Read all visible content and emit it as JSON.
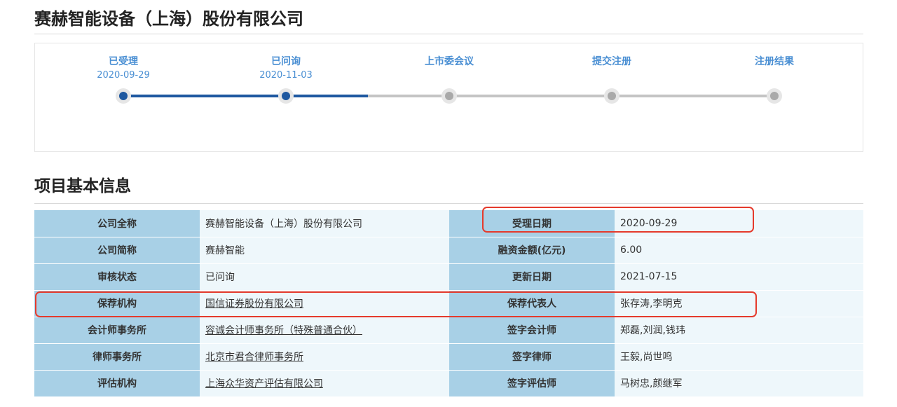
{
  "company_title": "赛赫智能设备（上海）股份有限公司",
  "progress": {
    "steps": [
      {
        "label": "已受理",
        "date": "2020-09-29",
        "done": true
      },
      {
        "label": "已问询",
        "date": "2020-11-03",
        "done": true
      },
      {
        "label": "上市委会议",
        "date": "",
        "done": false
      },
      {
        "label": "提交注册",
        "date": "",
        "done": false
      },
      {
        "label": "注册结果",
        "date": "",
        "done": false
      }
    ]
  },
  "section_title": "项目基本信息",
  "info_rows": [
    {
      "k1": "公司全称",
      "v1": "赛赫智能设备（上海）股份有限公司",
      "k2": "受理日期",
      "v2": "2020-09-29"
    },
    {
      "k1": "公司简称",
      "v1": "赛赫智能",
      "k2": "融资金额(亿元)",
      "v2": "6.00"
    },
    {
      "k1": "审核状态",
      "v1": "已问询",
      "k2": "更新日期",
      "v2": "2021-07-15"
    },
    {
      "k1": "保荐机构",
      "v1": "国信证券股份有限公司",
      "k2": "保荐代表人",
      "v2": "张存涛,李明克"
    },
    {
      "k1": "会计师事务所",
      "v1": "容诚会计师事务所（特殊普通合伙）",
      "k2": "签字会计师",
      "v2": "郑磊,刘润,钱玮"
    },
    {
      "k1": "律师事务所",
      "v1": "北京市君合律师事务所",
      "k2": "签字律师",
      "v2": "王毅,尚世鸣"
    },
    {
      "k1": "评估机构",
      "v1": "上海众华资产评估有限公司",
      "k2": "签字评估师",
      "v2": "马树忠,颜继军"
    }
  ],
  "colors": {
    "step_active": "#4a8fd3",
    "track_done": "#1e58a0",
    "track_pending": "#c4c4c4",
    "key_cell": "#a8d0e6",
    "value_cell": "#eef7fb",
    "highlight": "#e53a2c"
  }
}
